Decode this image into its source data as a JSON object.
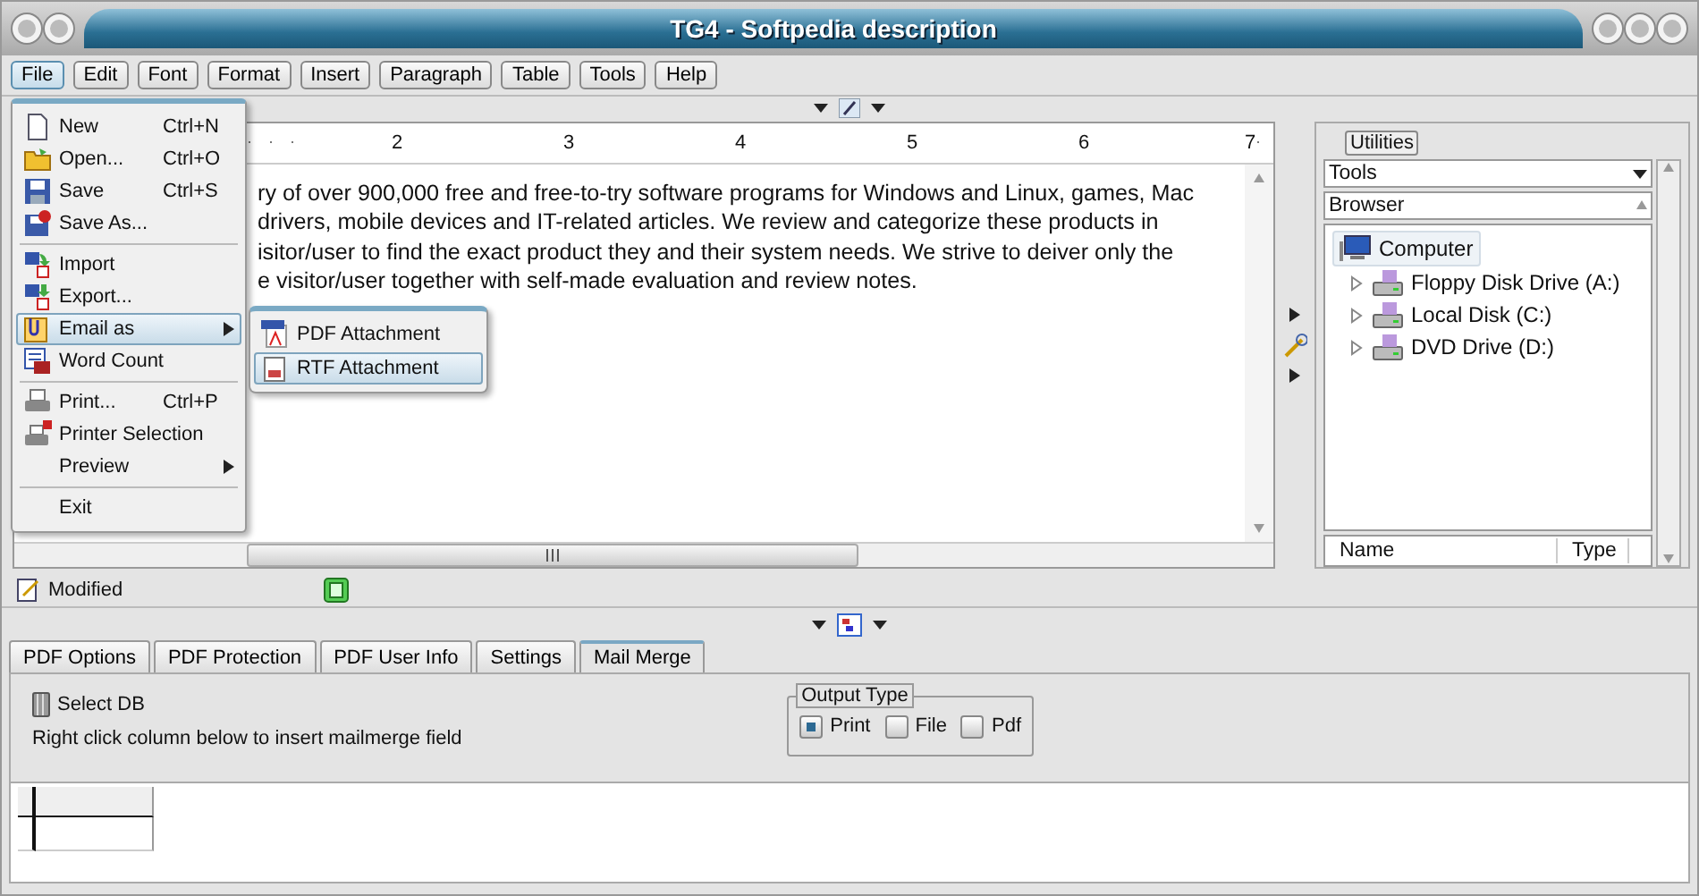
{
  "window": {
    "title": "TG4 - Softpedia description"
  },
  "menu_bar": [
    {
      "label": "File",
      "selected": true
    },
    {
      "label": "Edit",
      "selected": false
    },
    {
      "label": "Font",
      "selected": false
    },
    {
      "label": "Format",
      "selected": false
    },
    {
      "label": "Insert",
      "selected": false
    },
    {
      "label": "Paragraph",
      "selected": false
    },
    {
      "label": "Table",
      "selected": false
    },
    {
      "label": "Tools",
      "selected": false
    },
    {
      "label": "Help",
      "selected": false
    }
  ],
  "file_menu": [
    {
      "kind": "item",
      "label": "New",
      "shortcut": "Ctrl+N",
      "selected": false,
      "submenu": false
    },
    {
      "kind": "item",
      "label": "Open...",
      "shortcut": "Ctrl+O",
      "selected": false,
      "submenu": false
    },
    {
      "kind": "item",
      "label": "Save",
      "shortcut": "Ctrl+S",
      "selected": false,
      "submenu": false
    },
    {
      "kind": "item",
      "label": "Save As...",
      "selected": false,
      "submenu": false
    },
    {
      "kind": "separator"
    },
    {
      "kind": "item",
      "label": "Import",
      "selected": false,
      "submenu": false
    },
    {
      "kind": "item",
      "label": "Export...",
      "selected": false,
      "submenu": false
    },
    {
      "kind": "item",
      "label": "Email as",
      "selected": true,
      "submenu": true
    },
    {
      "kind": "item",
      "label": "Word Count",
      "selected": false,
      "submenu": false
    },
    {
      "kind": "separator"
    },
    {
      "kind": "item",
      "label": "Print...",
      "shortcut": "Ctrl+P",
      "selected": false,
      "submenu": false
    },
    {
      "kind": "item",
      "label": "Printer Selection",
      "selected": false,
      "submenu": false
    },
    {
      "kind": "item",
      "label": "Preview",
      "selected": false,
      "submenu": true
    },
    {
      "kind": "separator"
    },
    {
      "kind": "item",
      "label": "Exit",
      "selected": false,
      "submenu": false
    }
  ],
  "email_submenu": [
    {
      "label": "PDF Attachment",
      "selected": false
    },
    {
      "label": "RTF Attachment",
      "selected": true
    }
  ],
  "ruler": [
    "2",
    "3",
    "4",
    "5",
    "6",
    "7"
  ],
  "document": [
    "ry of over 900,000 free and free-to-try software programs for Windows and Linux, games, Mac",
    "drivers, mobile devices and IT-related articles. We review and categorize these products in",
    "isitor/user to find the exact product they and their system needs. We strive to deiver only the",
    "e visitor/user together with self-made evaluation and review notes."
  ],
  "status_bar": {
    "text": "Modified"
  },
  "utilities": {
    "title": "Utilities",
    "dropdown": "Tools",
    "section": "Browser",
    "tree": [
      {
        "label": "Computer",
        "selected": true,
        "children": [
          {
            "label": "Floppy Disk Drive (A:)",
            "expanded": false
          },
          {
            "label": "Local Disk (C:)",
            "expanded": false
          },
          {
            "label": "DVD Drive (D:)",
            "expanded": false
          }
        ]
      }
    ],
    "columns": [
      "Name",
      "Type"
    ]
  },
  "tabs": [
    {
      "label": "PDF Options",
      "selected": false
    },
    {
      "label": "PDF Protection",
      "selected": false
    },
    {
      "label": "PDF User Info",
      "selected": false
    },
    {
      "label": "Settings",
      "selected": false
    },
    {
      "label": "Mail Merge",
      "selected": true
    }
  ],
  "mail_merge": {
    "select_db": "Select DB",
    "hint": "Right click column below to insert mailmerge field",
    "output_type": {
      "title": "Output Type",
      "options": [
        {
          "label": "Print",
          "checked": true
        },
        {
          "label": "File",
          "checked": false
        },
        {
          "label": "Pdf",
          "checked": false
        }
      ]
    }
  }
}
